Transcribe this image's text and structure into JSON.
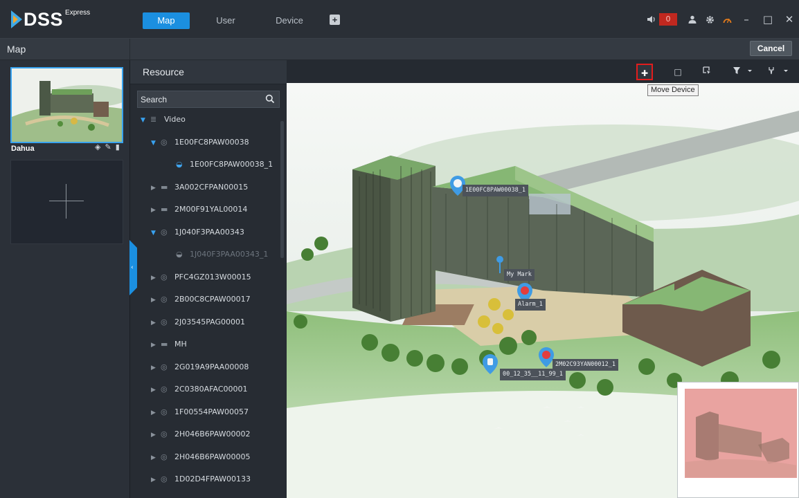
{
  "app": {
    "brand": "DSS",
    "edition": "Express",
    "tabs": [
      "Map",
      "User",
      "Device"
    ],
    "alarm_count": "0",
    "colors": {
      "accent": "#1b8fe0",
      "selection_border": "#39a3ef",
      "highlight": "#e21d1d",
      "alarm": "#c0281f"
    }
  },
  "mapbar": {
    "title": "Map",
    "cancel_label": "Cancel"
  },
  "maps": [
    {
      "name": "Dahua"
    }
  ],
  "resource": {
    "title": "Resource",
    "search_placeholder": "Search",
    "tree": [
      {
        "label": "Video",
        "icon": "video-group-icon",
        "expanded": true
      },
      {
        "label": "1E00FC8PAW00038",
        "icon": "camera-device-icon",
        "expanded": true
      },
      {
        "label": "1E00FC8PAW00038_1",
        "icon": "dome-camera-icon",
        "expanded": false
      },
      {
        "label": "3A002CFPAN00015",
        "icon": "nvr-icon",
        "expanded": false
      },
      {
        "label": "2M00F91YAL00014",
        "icon": "nvr-icon",
        "expanded": false
      },
      {
        "label": "1J040F3PAA00343",
        "icon": "camera-device-icon",
        "expanded": true
      },
      {
        "label": "1J040F3PAA00343_1",
        "icon": "dome-camera-icon",
        "expanded": false
      },
      {
        "label": "PFC4GZ013W00015",
        "icon": "camera-device-icon",
        "expanded": false
      },
      {
        "label": "2B00C8CPAW00017",
        "icon": "camera-device-icon",
        "expanded": false
      },
      {
        "label": "2J03545PAG00001",
        "icon": "camera-device-icon",
        "expanded": false
      },
      {
        "label": "MH",
        "icon": "nvr-icon",
        "expanded": false
      },
      {
        "label": "2G019A9PAA00008",
        "icon": "camera-device-icon",
        "expanded": false
      },
      {
        "label": "2C0380AFAC00001",
        "icon": "camera-device-icon",
        "expanded": false
      },
      {
        "label": "1F00554PAW00057",
        "icon": "camera-device-icon",
        "expanded": false
      },
      {
        "label": "2H046B6PAW00002",
        "icon": "camera-device-icon",
        "expanded": false
      },
      {
        "label": "2H046B6PAW00005",
        "icon": "camera-device-icon",
        "expanded": false
      },
      {
        "label": "1D02D4FPAW00133",
        "icon": "camera-device-icon",
        "expanded": false
      }
    ]
  },
  "map_toolbar": {
    "tooltip": "Move Device"
  },
  "map_markers": [
    {
      "label": "1E00FC8PAW00038_1",
      "kind": "camera"
    },
    {
      "label": "My Mark",
      "kind": "mark"
    },
    {
      "label": "Alarm_1",
      "kind": "alarm"
    },
    {
      "label": "2M02C93YAN00012_1",
      "kind": "alarm"
    },
    {
      "label": "00_12_35__11_99_1",
      "kind": "camera"
    }
  ]
}
